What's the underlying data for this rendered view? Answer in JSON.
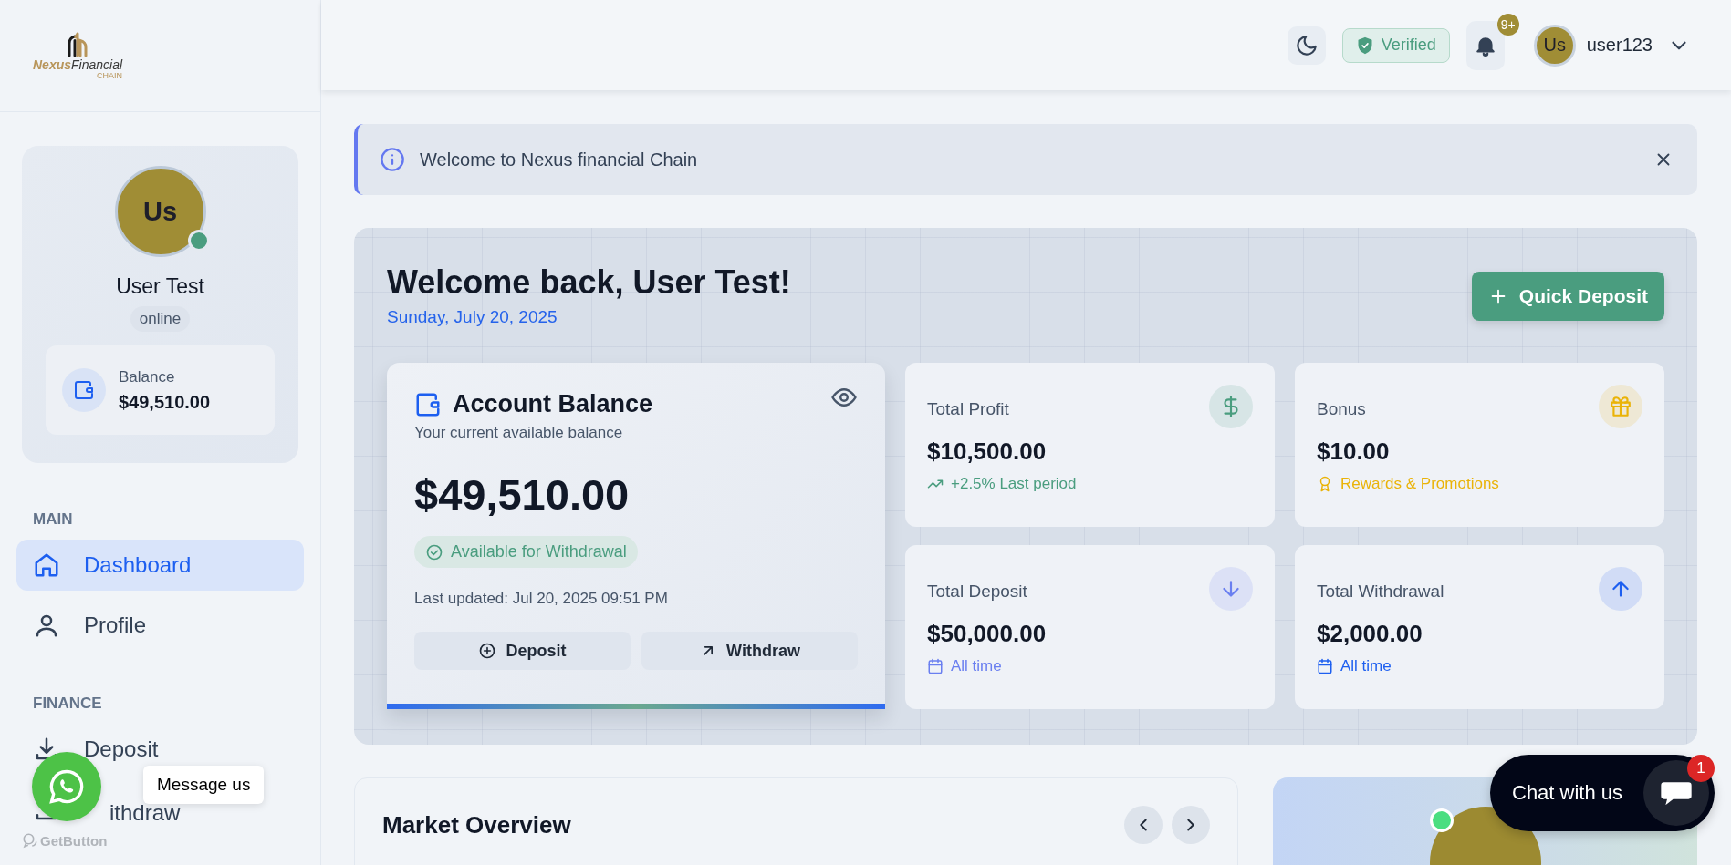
{
  "sidebar": {
    "logo": {
      "text": "**Nexus**Financial",
      "tagline": "CHAIN"
    },
    "profile": {
      "initials": "Us",
      "online": true,
      "name": "User Test",
      "status": "online",
      "balance_label": "Balance",
      "balance": "$49,510.00"
    },
    "sections": [
      {
        "title": "MAIN",
        "items": [
          {
            "kind": "home",
            "label": "Dashboard",
            "selected": true
          },
          {
            "kind": "user",
            "label": "Profile",
            "selected": false
          }
        ]
      },
      {
        "title": "FINANCE",
        "items": [
          {
            "kind": "download",
            "label": "Deposit",
            "selected": false
          },
          {
            "kind": "upload",
            "label": "ithdraw",
            "selected": false
          }
        ]
      }
    ]
  },
  "header": {
    "verified": "Verified",
    "notifications": {
      "badge": "9+"
    },
    "user": {
      "initials": "Us",
      "username": "user123"
    }
  },
  "alert": {
    "text": "Welcome to Nexus financial Chain"
  },
  "hero": {
    "title": "Welcome back, User Test!",
    "date": "Sunday, July 20, 2025",
    "quick_deposit": "Quick Deposit",
    "balance_card": {
      "title": "Account Balance",
      "subtitle": "Your current available balance",
      "amount": "$49,510.00",
      "badge": "Available for Withdrawal",
      "updated": "Last updated: Jul 20, 2025 09:51 PM",
      "actions": [
        {
          "kind": "deposit",
          "label": "Deposit"
        },
        {
          "kind": "withdraw",
          "label": "Withdraw"
        }
      ]
    },
    "stats": [
      {
        "kind": "profit",
        "label": "Total Profit",
        "value": "$10,500.00",
        "note": "+2.5% Last period",
        "color": "#4a9d7f"
      },
      {
        "kind": "bonus",
        "label": "Bonus",
        "value": "$10.00",
        "note": "Rewards & Promotions",
        "color": "#eab308"
      },
      {
        "kind": "deposit",
        "label": "Total Deposit",
        "value": "$50,000.00",
        "note": "All time",
        "color": "#6a7ff0"
      },
      {
        "kind": "withdrawal",
        "label": "Total Withdrawal",
        "value": "$2,000.00",
        "note": "All time",
        "color": "#1d5ff0"
      }
    ]
  },
  "market": {
    "title": "Market Overview"
  },
  "profile_card": {
    "online": true
  },
  "widgets": {
    "whatsapp": {
      "tooltip": "Message us",
      "brand": "GetButton"
    },
    "chat": {
      "label": "Chat with us",
      "badge": "1"
    }
  }
}
